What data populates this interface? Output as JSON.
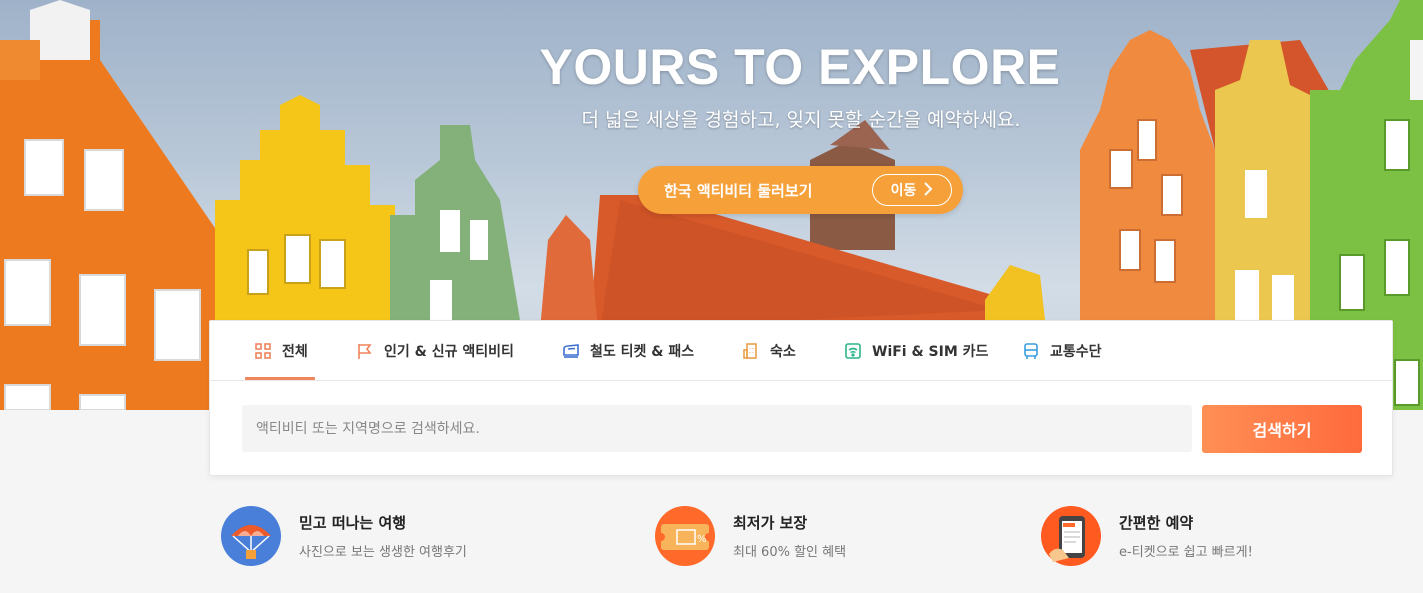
{
  "hero": {
    "title": "YOURS TO EXPLORE",
    "subtitle": "더 넓은 세상을 경험하고, 잊지 못할 순간을 예약하세요.",
    "korea_button_label": "한국 액티비티 둘러보기",
    "korea_go_label": "이동"
  },
  "tabs": [
    {
      "label": "전체",
      "icon": "grid-icon",
      "color": "#f0845b",
      "active": true
    },
    {
      "label": "인기 & 신규 액티비티",
      "icon": "flag-icon",
      "color": "#f0845b",
      "active": false
    },
    {
      "label": "철도 티켓 & 패스",
      "icon": "train-ticket-icon",
      "color": "#3d6fd1",
      "active": false
    },
    {
      "label": "숙소",
      "icon": "building-icon",
      "color": "#e8a04a",
      "active": false
    },
    {
      "label": "WiFi & SIM 카드",
      "icon": "wifi-icon",
      "color": "#2bb58a",
      "active": false
    },
    {
      "label": "교통수단",
      "icon": "bus-icon",
      "color": "#3b9ee0",
      "active": false
    }
  ],
  "search": {
    "placeholder": "액티비티 또는 지역명으로 검색하세요.",
    "button_label": "검색하기"
  },
  "features": [
    {
      "title": "믿고 떠나는 여행",
      "subtitle": "사진으로 보는 생생한 여행후기",
      "icon": "parachute-icon"
    },
    {
      "title": "최저가 보장",
      "subtitle": "최대 60% 할인 혜택",
      "icon": "ticket-icon"
    },
    {
      "title": "간편한 예약",
      "subtitle": "e-티켓으로 쉽고 빠르게!",
      "icon": "phone-booking-icon"
    }
  ],
  "colors": {
    "accent": "#ff6a3d",
    "korea_button": "#f6a03a",
    "tab_underline": "#f0845b"
  }
}
